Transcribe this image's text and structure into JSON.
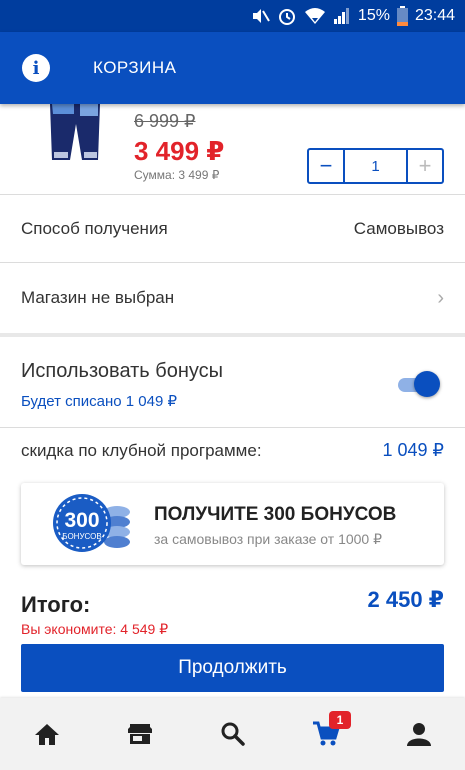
{
  "status_bar": {
    "battery": "15%",
    "time": "23:44"
  },
  "header": {
    "title": "КОРЗИНА"
  },
  "product": {
    "old_price": "6 999 ₽",
    "price": "3 499 ₽",
    "sum": "Сумма: 3 499 ₽",
    "quantity": "1",
    "minus": "−",
    "plus": "+"
  },
  "delivery": {
    "label": "Способ получения",
    "value": "Самовывоз"
  },
  "store": {
    "label": "Магазин не выбран",
    "chevron": "›"
  },
  "bonuses": {
    "title": "Использовать бонусы",
    "subtitle": "Будет списано 1 049 ₽",
    "enabled": true
  },
  "club_discount": {
    "label": "скидка по клубной программе:",
    "value": "1 049 ₽"
  },
  "promo": {
    "badge_number": "300",
    "badge_text": "БОНУСОВ",
    "title": "ПОЛУЧИТЕ 300 БОНУСОВ",
    "subtitle": "за самовывоз при заказе от 1000 ₽"
  },
  "total": {
    "label": "Итого:",
    "value": "2 450 ₽",
    "savings": "Вы экономите: 4 549 ₽"
  },
  "actions": {
    "continue_label": "Продолжить"
  },
  "bottom_nav": {
    "cart_badge": "1",
    "items": [
      "home-icon",
      "store-icon",
      "search-icon",
      "cart-icon",
      "profile-icon"
    ]
  },
  "colors": {
    "brand_blue": "#0a4fbf",
    "price_red": "#e2232a",
    "status_bar": "#003d9e"
  }
}
